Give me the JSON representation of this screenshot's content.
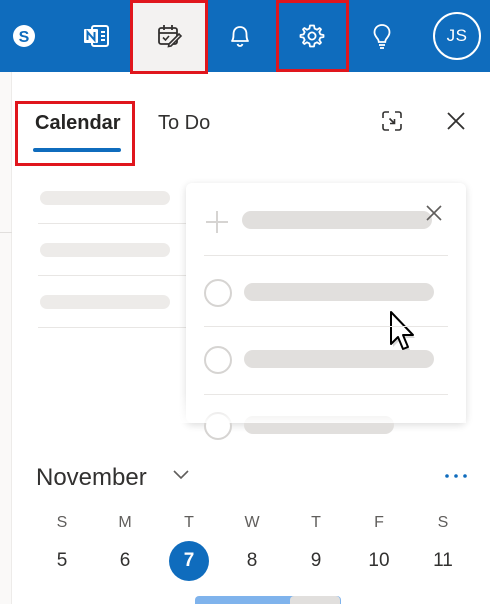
{
  "topbar": {
    "background": "#0f6cbd",
    "icons": [
      "skype-icon",
      "onenote-icon",
      "my-day-icon",
      "bell-icon",
      "gear-icon",
      "lightbulb-icon"
    ],
    "avatar_initials": "JS",
    "highlight_color": "#e0161d"
  },
  "panel": {
    "tabs": [
      {
        "label": "Calendar",
        "selected": true
      },
      {
        "label": "To Do",
        "selected": false
      }
    ],
    "accent": "#0f6cbd"
  },
  "calendar": {
    "month": "November",
    "weekdays": [
      "S",
      "M",
      "T",
      "W",
      "T",
      "F",
      "S"
    ],
    "days": [
      "5",
      "6",
      "7",
      "8",
      "9",
      "10",
      "11"
    ],
    "today": "7"
  }
}
